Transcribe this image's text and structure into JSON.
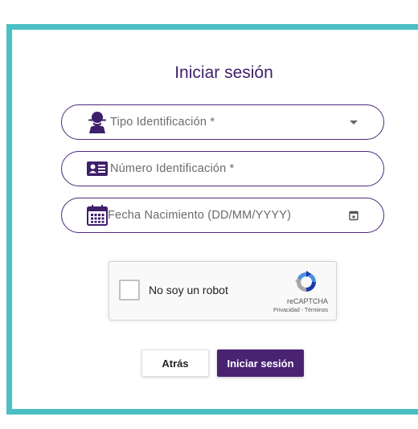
{
  "form": {
    "title": "Iniciar sesión",
    "fields": [
      {
        "label": "Tipo Identificación *",
        "icon": "user-icon",
        "trailing_icon": "dropdown-arrow-icon"
      },
      {
        "label": "Número Identificación *",
        "icon": "id-card-icon"
      },
      {
        "label": "Fecha Nacimiento (DD/MM/YYYY)",
        "icon": "calendar-icon",
        "trailing_icon": "calendar-small-icon"
      }
    ]
  },
  "captcha": {
    "label": "No soy un robot",
    "brand": "reCAPTCHA",
    "links": "Privacidad - Términos"
  },
  "buttons": {
    "back_label": "Atrás",
    "login_label": "Iniciar sesión"
  },
  "colors": {
    "accent": "#4a2272",
    "frame": "#4bbfc3",
    "icon": "#3e1f6b"
  }
}
